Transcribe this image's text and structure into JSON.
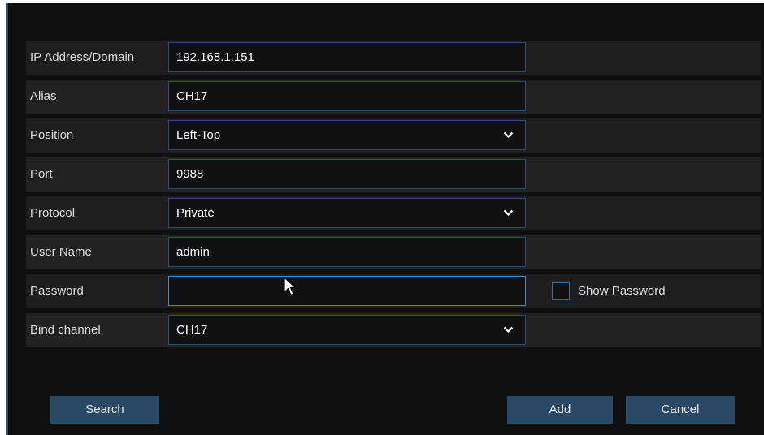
{
  "form": {
    "ip_address": {
      "label": "IP Address/Domain",
      "value": "192.168.1.151"
    },
    "alias": {
      "label": "Alias",
      "value": "CH17"
    },
    "position": {
      "label": "Position",
      "value": "Left-Top"
    },
    "port": {
      "label": "Port",
      "value": "9988"
    },
    "protocol": {
      "label": "Protocol",
      "value": "Private"
    },
    "user_name": {
      "label": "User Name",
      "value": "admin"
    },
    "password": {
      "label": "Password",
      "value": "",
      "show_password_label": "Show Password",
      "show_password_checked": false
    },
    "bind_channel": {
      "label": "Bind channel",
      "value": "CH17"
    }
  },
  "buttons": {
    "search": "Search",
    "add": "Add",
    "cancel": "Cancel"
  },
  "colors": {
    "background": "#0f0f10",
    "row": "#1e1e20",
    "field_border": "#2c4d6b",
    "button": "#2a4966",
    "text": "#dcdcdc"
  },
  "icons": {
    "dropdown": "chevron-down-icon",
    "cursor": "mouse-pointer-icon"
  }
}
